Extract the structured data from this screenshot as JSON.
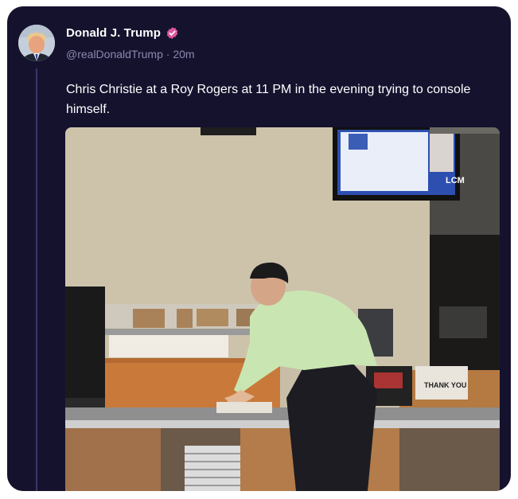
{
  "tweet": {
    "author": {
      "display_name": "Donald J. Trump",
      "handle": "@realDonaldTrump",
      "verified_badge_color": "#e0569f",
      "verified_icon": "verified-check-icon"
    },
    "separator": "·",
    "time_ago": "20m",
    "text": "Chris Christie at a Roy Rogers at 11 PM in the evening trying to console himself.",
    "photo": {
      "sign_text": "THANK YOU",
      "tv_logo": "LCM"
    }
  },
  "colors": {
    "card_background": "#15122e",
    "text_primary": "#ffffff",
    "text_secondary": "#8c88ad",
    "thread_line": "#3a3568"
  }
}
